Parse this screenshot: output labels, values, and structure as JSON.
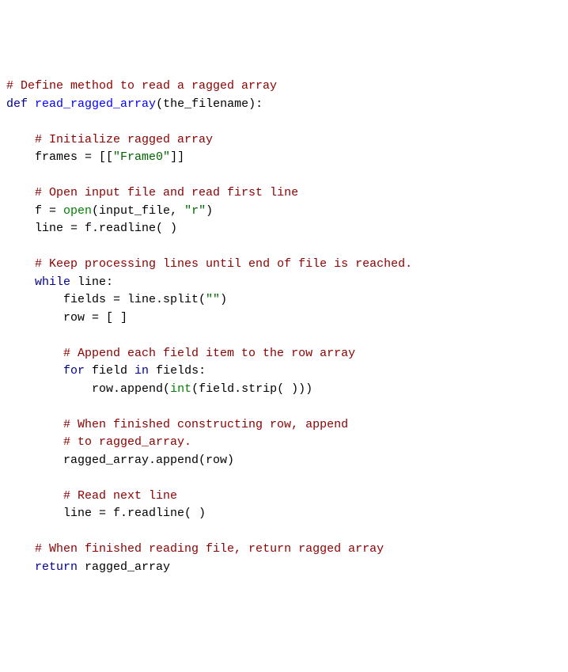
{
  "tokens": {
    "l1c1": "# Define method to read a ragged array",
    "l2k1": "def",
    "l2f1": "read_ragged_array",
    "l2t1": "(the_filename):",
    "l4c1": "# Initialize ragged array",
    "l5t1": "frames = [[",
    "l5s1": "\"Frame0\"",
    "l5t2": "]]",
    "l7c1": "# Open input file and read first line",
    "l8t1": "f = ",
    "l8b1": "open",
    "l8t2": "(input_file, ",
    "l8s1": "\"r\"",
    "l8t3": ")",
    "l9t1": "line = f.readline( )",
    "l11c1": "# Keep processing lines until end of file is reached.",
    "l12k1": "while",
    "l12t1": " line:",
    "l13t1": "fields = line.split(",
    "l13s1": "\"\"",
    "l13t2": ")",
    "l14t1": "row = [ ]",
    "l16c1": "# Append each field item to the row array",
    "l17k1": "for",
    "l17t1": " field ",
    "l17k2": "in",
    "l17t2": " fields:",
    "l18t1": "row.append(",
    "l18b1": "int",
    "l18t2": "(field.strip( )))",
    "l20c1": "# When finished constructing row, append",
    "l21c1": "# to ragged_array.",
    "l22t1": "ragged_array.append(row)",
    "l24c1": "# Read next line",
    "l25t1": "line = f.readline( )",
    "l27c1": "# When finished reading file, return ragged array",
    "l28k1": "return",
    "l28t1": " ragged_array"
  }
}
